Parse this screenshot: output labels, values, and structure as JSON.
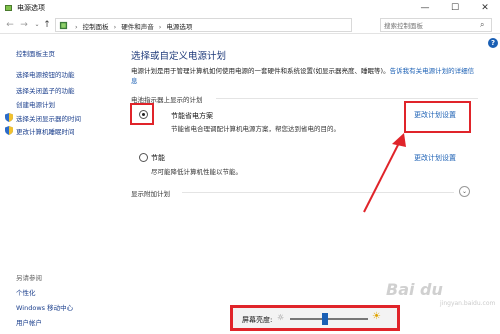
{
  "window": {
    "title": "电源选项",
    "min": "—",
    "max": "☐",
    "close": "✕"
  },
  "navbar": {
    "breadcrumbs": [
      "控制面板",
      "硬件和声音",
      "电源选项"
    ],
    "search_placeholder": "搜索控制面板"
  },
  "sidebar": {
    "home": "控制面板主页",
    "items": [
      "选择电源按钮的功能",
      "选择关闭盖子的功能",
      "创建电源计划",
      "选择关闭显示器的时间",
      "更改计算机睡眠时间"
    ],
    "see_also": "另请参阅",
    "see_also_items": [
      "个性化",
      "Windows 移动中心",
      "用户帐户"
    ]
  },
  "main": {
    "title": "选择或自定义电源计划",
    "intro_text": "电源计划是用于管理计算机如何使用电源的一套硬件和系统设置(如显示器亮度、睡眠等)。",
    "intro_link": "告诉我有关电源计划的详细信息",
    "section_label": "电池指示器上显示的计划",
    "plans": [
      {
        "name": "节能省电方案",
        "desc": "节能省电合理调配计算机电源方案，帮您达到省电的目的。",
        "selected": true,
        "change_link": "更改计划设置"
      },
      {
        "name": "节能",
        "desc": "尽可能降低计算机性能以节能。",
        "selected": false,
        "change_link": "更改计划设置"
      }
    ],
    "extra_label": "显示附加计划"
  },
  "bottom": {
    "brightness_label": "屏幕亮度:",
    "brightness_fraction": 0.45
  },
  "watermark": {
    "main": "Bai du",
    "sub": "jingyan.baidu.com"
  },
  "colors": {
    "annotation_red": "#e0242a",
    "link_blue": "#1a5fb4",
    "title_blue": "#1e3a7a"
  }
}
